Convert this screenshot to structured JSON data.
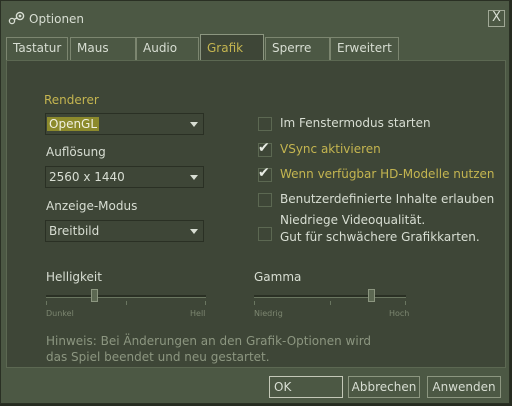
{
  "window": {
    "title": "Optionen",
    "close_label": "X"
  },
  "tabs": [
    {
      "label": "Tastatur",
      "active": false
    },
    {
      "label": "Maus",
      "active": false
    },
    {
      "label": "Audio",
      "active": false
    },
    {
      "label": "Grafik",
      "active": true
    },
    {
      "label": "Sperre",
      "active": false
    },
    {
      "label": "Erweitert",
      "active": false
    }
  ],
  "renderer": {
    "label": "Renderer",
    "value": "OpenGL"
  },
  "resolution": {
    "label": "Auflösung",
    "value": "2560 x 1440"
  },
  "display_mode": {
    "label": "Anzeige-Modus",
    "value": "Breitbild"
  },
  "options": [
    {
      "label": "Im Fenstermodus starten",
      "checked": false
    },
    {
      "label": "VSync aktivieren",
      "checked": true
    },
    {
      "label": "Wenn verfügbar HD-Modelle nutzen",
      "checked": true
    },
    {
      "label": "Benutzerdefinierte Inhalte erlauben",
      "checked": false
    },
    {
      "label_line1": "Niedriege Videoqualität.",
      "label_line2": "Gut für schwächere Grafikkarten.",
      "checked": false
    }
  ],
  "brightness": {
    "label": "Helligkeit",
    "min_label": "Dunkel",
    "max_label": "Hell",
    "value_fraction": 0.3
  },
  "gamma": {
    "label": "Gamma",
    "min_label": "Niedrig",
    "max_label": "Hoch",
    "value_fraction": 0.77
  },
  "hint": {
    "line1": "Hinweis: Bei Änderungen an den Grafik-Optionen wird",
    "line2": "das Spiel beendet und neu gestartet."
  },
  "buttons": {
    "ok": "OK",
    "cancel": "Abbrechen",
    "apply": "Anwenden"
  },
  "colors": {
    "background": "#4c5844",
    "panel": "#3e4637",
    "accent_gold": "#c4b550",
    "text": "#d8ded3"
  }
}
